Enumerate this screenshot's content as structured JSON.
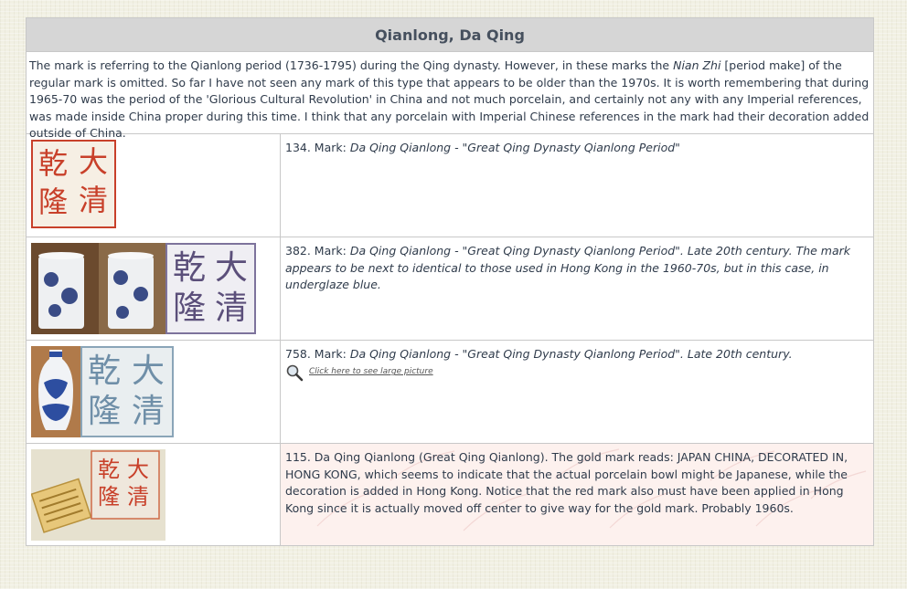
{
  "header": {
    "title": "Qianlong, Da Qing"
  },
  "intro": {
    "part1": "The mark is referring to the Qianlong period (1736-1795) during the Qing dynasty. However, in these marks the ",
    "italic": "Nian Zhi",
    "part2": " [period make] of the regular mark is omitted. So far I have not seen any mark of this type that appears to be older than the 1970s. It is worth remembering that during 1965-70 was the period of the 'Glorious Cultural Revolution' in China and not much porcelain, and certainly not any with any Imperial references, was made inside China proper during this time. I think that any porcelain with Imperial Chinese references in the mark had their decoration added outside of China."
  },
  "rows": [
    {
      "number": "134. Mark: ",
      "desc": "Da Qing Qianlong - \"Great Qing Dynasty Qianlong Period\"",
      "seal_chars": [
        "乾",
        "大",
        "隆",
        "清"
      ]
    },
    {
      "number": "382. Mark: ",
      "desc": "Da Qing Qianlong - \"Great Qing Dynasty Qianlong Period\". Late 20th century. The mark appears to be next to identical to those used in Hong Kong in the 1960-70s, but in this case, in underglaze blue.",
      "seal_chars": [
        "乾",
        "大",
        "隆",
        "清"
      ]
    },
    {
      "number": "758. Mark: ",
      "desc": "Da Qing Qianlong - \"Great Qing Dynasty Qianlong Period\". Late 20th century.",
      "link": "Click here to see large picture",
      "seal_chars": [
        "乾",
        "大",
        "隆",
        "清"
      ]
    },
    {
      "text": "115. Da Qing Qianlong (Great Qing Qianlong). The gold mark reads: JAPAN CHINA, DECORATED IN, HONG KONG, which seems to indicate that the actual porcelain bowl might be Japanese, while the decoration is added in Hong Kong. Notice that the red mark also must have been applied in Hong Kong since it is actually moved off center to give way for the gold mark. Probably 1960s.",
      "seal_chars": [
        "乾",
        "大",
        "隆",
        "清"
      ]
    }
  ],
  "colors": {
    "red_seal": "#c8402a",
    "blue_seal": "#6f8fa8",
    "purple_seal": "#5b4f7a",
    "header_bg": "#d6d6d6"
  }
}
